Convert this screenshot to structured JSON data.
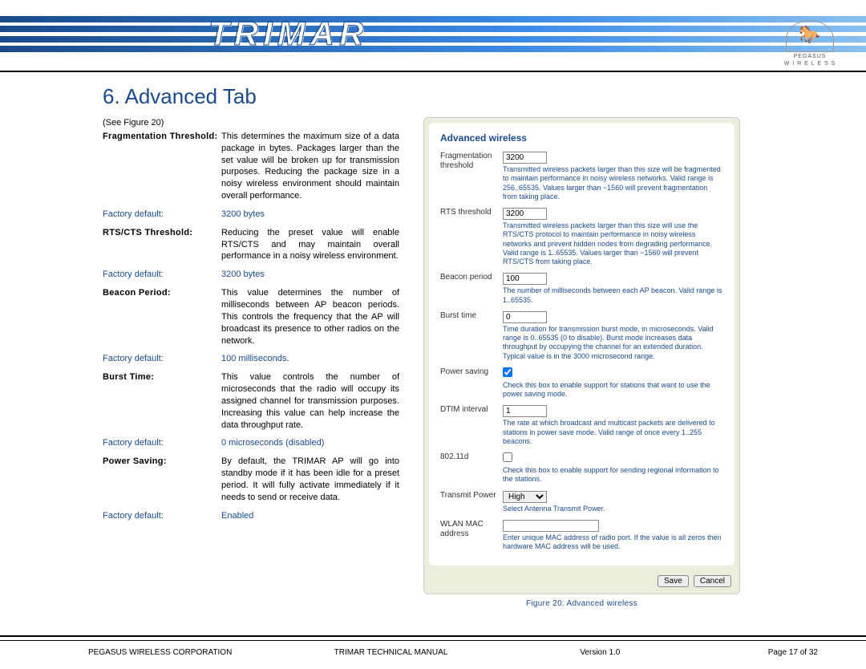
{
  "brand": "TRIMAR",
  "logo_sub1": "PEGASUS",
  "logo_sub2": "W I R E L E S S",
  "title": "6. Advanced Tab",
  "see_figure": "(See Figure 20)",
  "sections": {
    "frag": {
      "label": "Fragmentation Threshold:",
      "desc": "This determines the maximum size of a data package in bytes. Packages larger than the set value will be broken up for transmission purposes. Reducing the package size in a noisy wireless environment should maintain overall performance.",
      "fd_label": "Factory default:",
      "fd_val": "3200 bytes"
    },
    "rts": {
      "label": "RTS/CTS Threshold:",
      "desc": "Reducing the preset value will enable RTS/CTS and may maintain overall performance in a noisy wireless environment.",
      "fd_label": "Factory default:",
      "fd_val": "3200 bytes"
    },
    "beacon": {
      "label": "Beacon Period:",
      "desc": "This value determines the number of milliseconds between AP beacon periods. This controls the frequency that the AP will broadcast its presence to other radios on the network.",
      "fd_label": "Factory default:",
      "fd_val": "100 milliseconds."
    },
    "burst": {
      "label": "Burst Time:",
      "desc": "This value controls the number of microseconds that the radio will occupy its assigned channel for transmission purposes. Increasing this value can help increase the data throughput rate.",
      "fd_label": "Factory default:",
      "fd_val": "0 microseconds (disabled)"
    },
    "power": {
      "label": "Power Saving:",
      "desc": "By default, the TRIMAR AP will go into standby mode if it has been idle for a preset period. It will fully activate immediately if it needs to send or receive data.",
      "fd_label": "Factory default:",
      "fd_val": "Enabled"
    }
  },
  "panel": {
    "title": "Advanced wireless",
    "rows": {
      "frag": {
        "label": "Fragmentation threshold",
        "value": "3200",
        "help": "Transmitted wireless packets larger than this size will be fragmented to maintain performance in noisy wireless networks. Valid range is 256..65535. Values larger than ~1560 will prevent fragmentation from taking place."
      },
      "rts": {
        "label": "RTS threshold",
        "value": "3200",
        "help": "Transmitted wireless packets larger than this size will use the RTS/CTS protocol to maintain performance in noisy wireless networks and prevent hidden nodes from degrading performance. Valid range is 1..65535. Values larger than ~1560 will prevent RTS/CTS from taking place."
      },
      "beacon": {
        "label": "Beacon period",
        "value": "100",
        "help": "The number of milliseconds between each AP beacon. Valid range is 1..65535."
      },
      "burst": {
        "label": "Burst time",
        "value": "0",
        "help": "Time duration for transmission burst mode, in microseconds. Valid range is 0..65535 (0 to disable). Burst mode increases data throughput by occupying the channel for an extended duration. Typical value is in the 3000 microsecond range."
      },
      "psave": {
        "label": "Power saving",
        "checked": true,
        "help": "Check this box to enable support for stations that want to use the power saving mode."
      },
      "dtim": {
        "label": "DTIM interval",
        "value": "1",
        "help": "The rate at which broadcast and multicast packets are delivered to stations in power save mode. Valid range of once every 1..255 beacons."
      },
      "d802": {
        "label": "802.11d",
        "checked": false,
        "help": "Check this box to enable support for sending regional information to the stations."
      },
      "txp": {
        "label": "Transmit Power",
        "value": "High",
        "help": "Select Antenna Transmit Power."
      },
      "mac": {
        "label": "WLAN MAC address",
        "value": "",
        "help": "Enter unique MAC address of radio port. If the value is all zeros then hardware MAC address will be used."
      }
    },
    "save": "Save",
    "cancel": "Cancel"
  },
  "fig_caption": "Figure 20: Advanced wireless",
  "footer": {
    "company": "PEGASUS WIRELESS CORPORATION",
    "manual": "TRIMAR TECHNICAL MANUAL",
    "version": "Version 1.0",
    "page": "Page 17 of 32"
  }
}
